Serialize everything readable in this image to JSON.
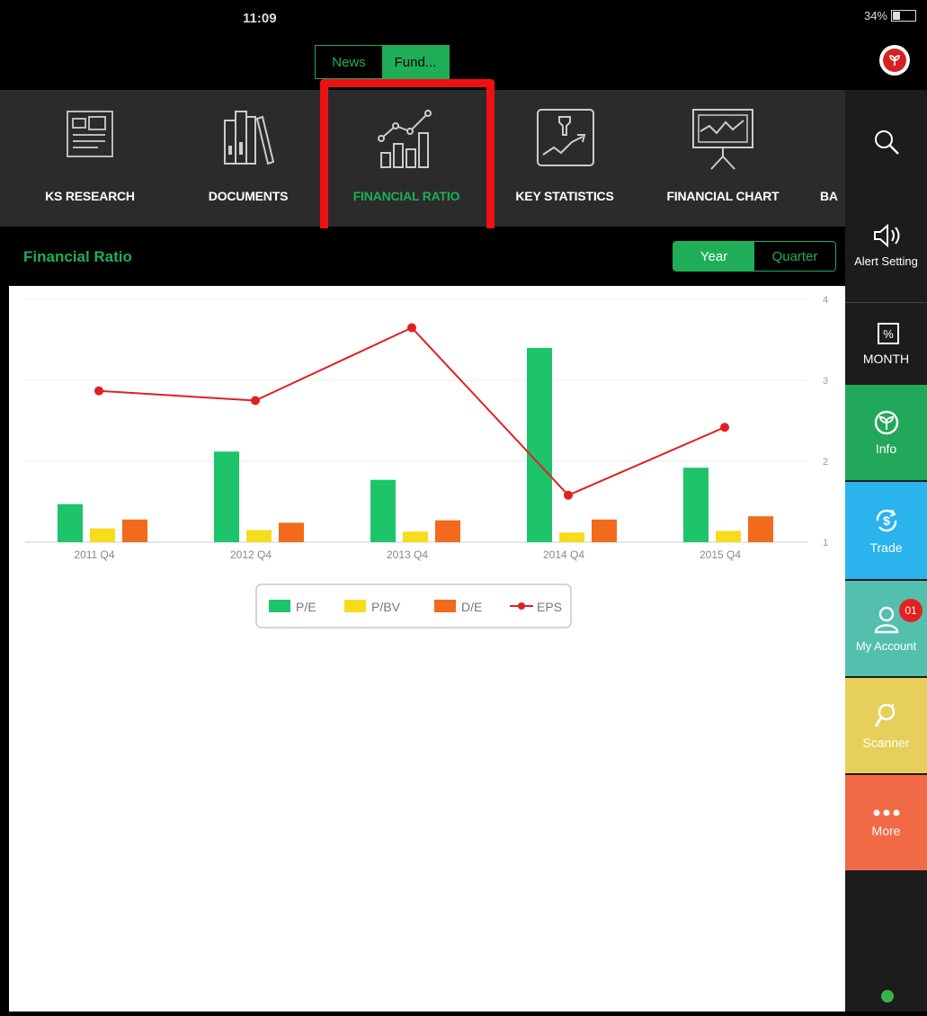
{
  "status_bar": {
    "time": "11:09",
    "battery": "34%",
    "battery_level": 0.34
  },
  "top_segment": {
    "news": "News",
    "fund": "Fund..."
  },
  "menu": [
    {
      "label": "KS RESEARCH",
      "icon": "research-icon"
    },
    {
      "label": "DOCUMENTS",
      "icon": "documents-icon"
    },
    {
      "label": "FINANCIAL RATIO",
      "icon": "financial-ratio-icon",
      "active": true
    },
    {
      "label": "KEY STATISTICS",
      "icon": "key-statistics-icon"
    },
    {
      "label": "FINANCIAL CHART",
      "icon": "financial-chart-icon"
    },
    {
      "label": "BA",
      "icon": ""
    }
  ],
  "section": {
    "title": "Financial Ratio",
    "year": "Year",
    "quarter": "Quarter"
  },
  "sidebar": {
    "search_icon": "search-icon",
    "alert": "Alert Setting",
    "month": "MONTH",
    "info": "Info",
    "trade": "Trade",
    "account": "My Account",
    "account_badge": "01",
    "scanner": "Scanner",
    "more": "More",
    "colors": {
      "info": "#22a85a",
      "trade": "#2ab3ec",
      "account": "#55bfae",
      "scanner": "#e6cf5a",
      "more": "#f26a45"
    }
  },
  "chart_data": {
    "type": "bar",
    "categories": [
      "2011 Q4",
      "2012 Q4",
      "2013 Q4",
      "2014 Q4",
      "2015 Q4"
    ],
    "ylim": [
      1,
      4
    ],
    "yticks": [
      1,
      2,
      3,
      4
    ],
    "grid": true,
    "legend_position": "bottom-center",
    "series": [
      {
        "name": "P/E",
        "type": "bar",
        "color": "#1ec46a",
        "values": [
          1.47,
          2.12,
          1.77,
          3.4,
          1.92
        ]
      },
      {
        "name": "P/BV",
        "type": "bar",
        "color": "#f7dc1e",
        "values": [
          1.17,
          1.15,
          1.13,
          1.12,
          1.14
        ]
      },
      {
        "name": "D/E",
        "type": "bar",
        "color": "#f26a1b",
        "values": [
          1.28,
          1.24,
          1.27,
          1.28,
          1.32
        ]
      },
      {
        "name": "EPS",
        "type": "line",
        "color": "#e02020",
        "values": [
          2.87,
          2.75,
          3.65,
          1.58,
          2.42
        ]
      }
    ]
  }
}
